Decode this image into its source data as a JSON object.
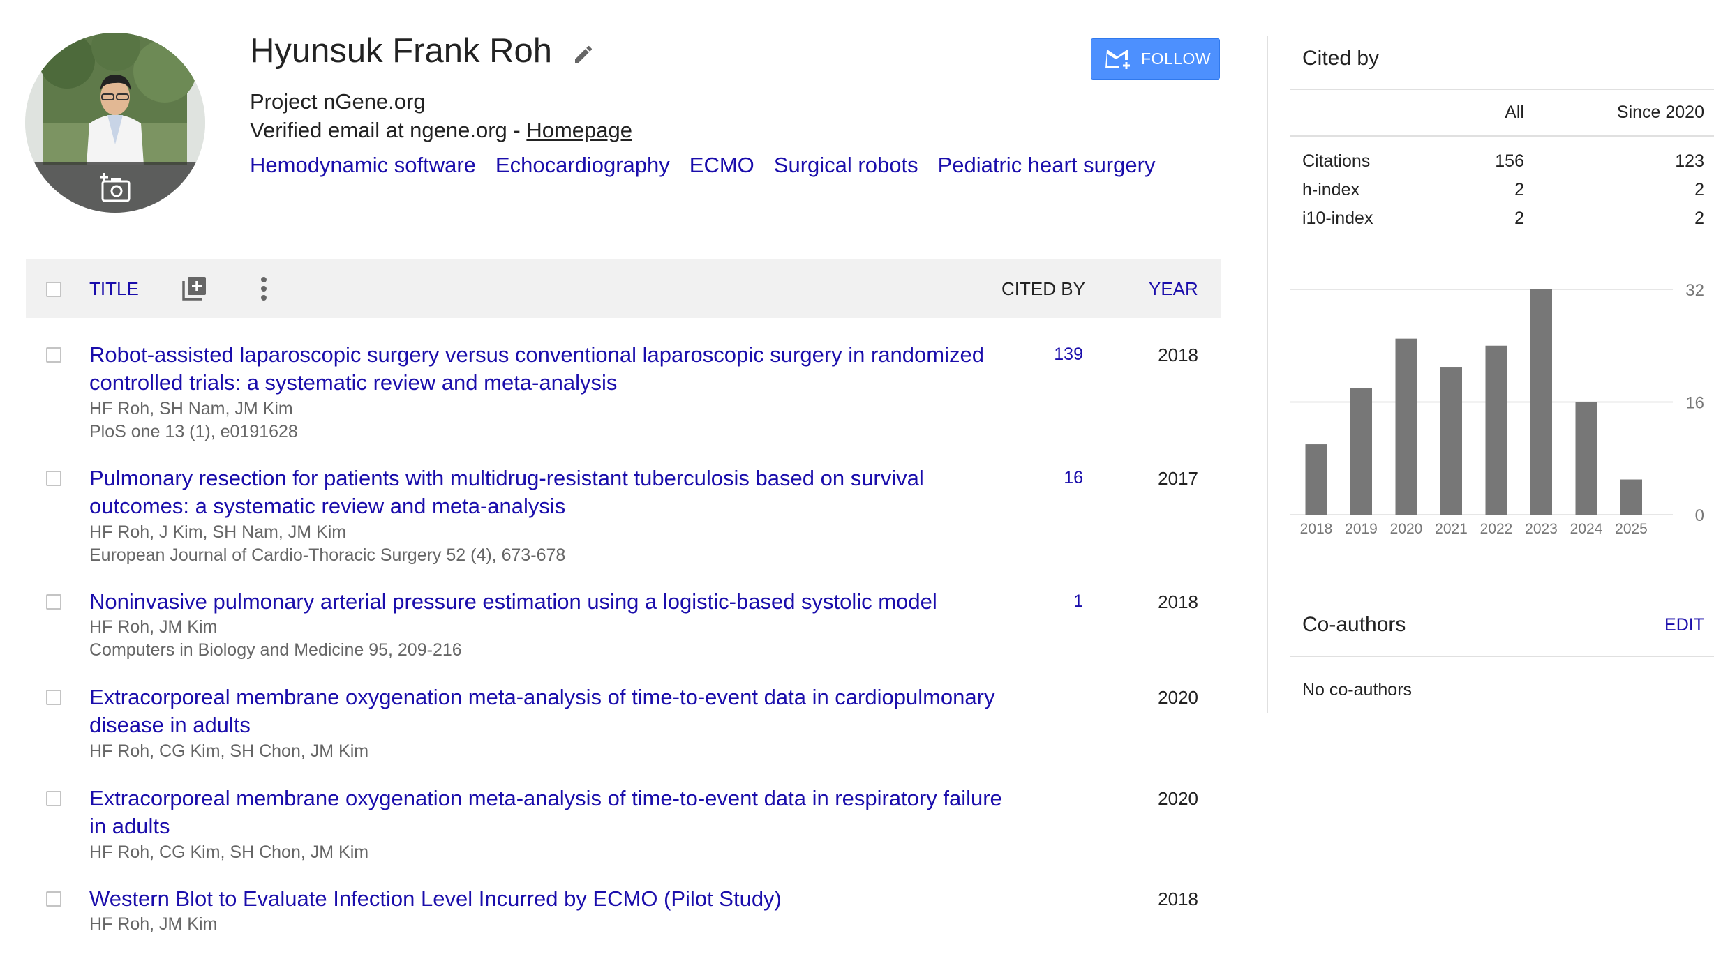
{
  "profile": {
    "name": "Hyunsuk Frank Roh",
    "affiliation": "Project nGene.org",
    "email_text": "Verified email at ngene.org - ",
    "homepage_label": "Homepage",
    "interests": [
      "Hemodynamic software",
      "Echocardiography",
      "ECMO",
      "Surgical robots",
      "Pediatric heart surgery"
    ],
    "follow_label": "FOLLOW",
    "icons": {
      "edit": "pencil-icon",
      "photo": "add-photo-icon",
      "follow": "email-plus-icon"
    }
  },
  "table": {
    "title_label": "TITLE",
    "cited_by_label": "CITED BY",
    "year_label": "YEAR",
    "icons": {
      "add": "add-library-icon",
      "more": "more-vert-icon"
    },
    "rows": [
      {
        "title": "Robot-assisted laparoscopic surgery versus conventional laparoscopic surgery in randomized controlled trials: a systematic review and meta-analysis",
        "authors": "HF Roh, SH Nam, JM Kim",
        "venue": "PloS one 13 (1), e0191628",
        "cited_by": "139",
        "year": "2018"
      },
      {
        "title": "Pulmonary resection for patients with multidrug-resistant tuberculosis based on survival outcomes: a systematic review and meta-analysis",
        "authors": "HF Roh, J Kim, SH Nam, JM Kim",
        "venue": "European Journal of Cardio-Thoracic Surgery 52 (4), 673-678",
        "cited_by": "16",
        "year": "2017"
      },
      {
        "title": "Noninvasive pulmonary arterial pressure estimation using a logistic-based systolic model",
        "authors": "HF Roh, JM Kim",
        "venue": "Computers in Biology and Medicine 95, 209-216",
        "cited_by": "1",
        "year": "2018"
      },
      {
        "title": "Extracorporeal membrane oxygenation meta-analysis of time-to-event data in cardiopulmonary disease in adults",
        "authors": "HF Roh, CG Kim, SH Chon, JM Kim",
        "venue": "",
        "cited_by": "",
        "year": "2020"
      },
      {
        "title": "Extracorporeal membrane oxygenation meta-analysis of time-to-event data in respiratory failure in adults",
        "authors": "HF Roh, CG Kim, SH Chon, JM Kim",
        "venue": "",
        "cited_by": "",
        "year": "2020"
      },
      {
        "title": "Western Blot to Evaluate Infection Level Incurred by ECMO (Pilot Study)",
        "authors": "HF Roh, JM Kim",
        "venue": "",
        "cited_by": "",
        "year": "2018"
      }
    ]
  },
  "cited_by": {
    "title": "Cited by",
    "col_all": "All",
    "col_since": "Since 2020",
    "stats": [
      {
        "label": "Citations",
        "all": "156",
        "since": "123"
      },
      {
        "label": "h-index",
        "all": "2",
        "since": "2"
      },
      {
        "label": "i10-index",
        "all": "2",
        "since": "2"
      }
    ]
  },
  "chart_data": {
    "type": "bar",
    "categories": [
      "2018",
      "2019",
      "2020",
      "2021",
      "2022",
      "2023",
      "2024",
      "2025"
    ],
    "values": [
      10,
      18,
      25,
      21,
      24,
      32,
      16,
      5
    ],
    "yticks": [
      "0",
      "16",
      "32"
    ],
    "ylim": [
      0,
      32
    ],
    "bar_color": "#777777",
    "grid": true
  },
  "coauthors": {
    "title": "Co-authors",
    "edit_label": "EDIT",
    "empty_text": "No co-authors"
  }
}
